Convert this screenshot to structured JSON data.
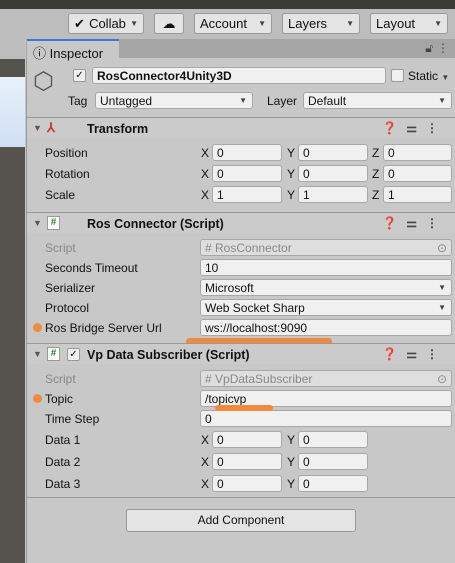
{
  "toolbar": {
    "collab": "Collab",
    "account": "Account",
    "layers": "Layers",
    "layout": "Layout"
  },
  "inspector": {
    "tab": "Inspector",
    "object_name": "RosConnector4Unity3D",
    "static_label": "Static",
    "tag_label": "Tag",
    "tag_value": "Untagged",
    "layer_label": "Layer",
    "layer_value": "Default"
  },
  "transform": {
    "title": "Transform",
    "rows": [
      {
        "label": "Position",
        "x": "0",
        "y": "0",
        "z": "0"
      },
      {
        "label": "Rotation",
        "x": "0",
        "y": "0",
        "z": "0"
      },
      {
        "label": "Scale",
        "x": "1",
        "y": "1",
        "z": "1"
      }
    ],
    "x": "X",
    "y": "Y",
    "z": "Z"
  },
  "ros_connector": {
    "title": "Ros Connector (Script)",
    "script_label": "Script",
    "script_value": "RosConnector",
    "timeout_label": "Seconds Timeout",
    "timeout_value": "10",
    "serializer_label": "Serializer",
    "serializer_value": "Microsoft",
    "protocol_label": "Protocol",
    "protocol_value": "Web Socket Sharp",
    "url_label": "Ros Bridge Server Url",
    "url_value": "ws://localhost:9090"
  },
  "vp_subscriber": {
    "title": "Vp Data Subscriber (Script)",
    "script_label": "Script",
    "script_value": "VpDataSubscriber",
    "topic_label": "Topic",
    "topic_value": "/topicvp",
    "timestep_label": "Time Step",
    "timestep_value": "0",
    "data_rows": [
      {
        "label": "Data 1",
        "x": "0",
        "y": "0"
      },
      {
        "label": "Data 2",
        "x": "0",
        "y": "0"
      },
      {
        "label": "Data 3",
        "x": "0",
        "y": "0"
      }
    ]
  },
  "add_component": "Add Component",
  "colors": {
    "annotation": "#f08a40",
    "accent": "#3a79d8"
  }
}
